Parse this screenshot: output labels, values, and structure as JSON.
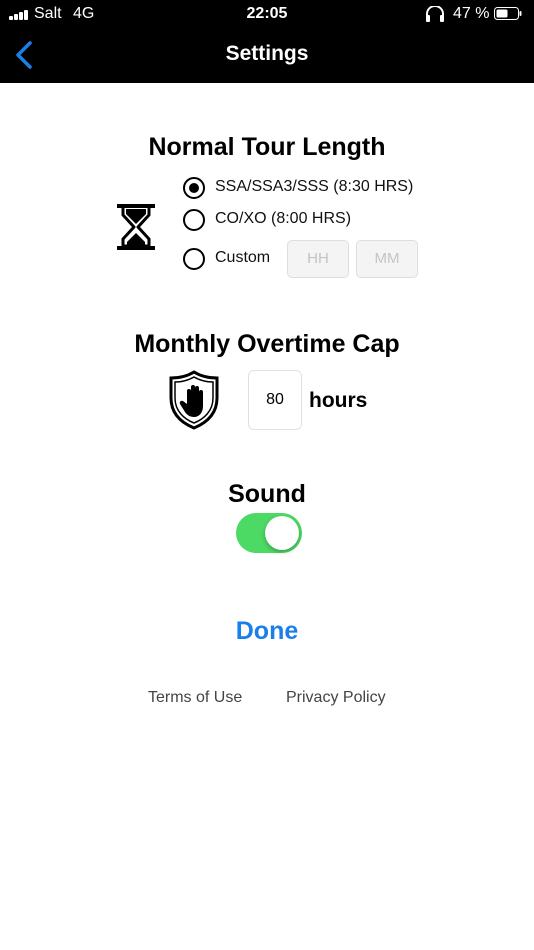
{
  "status_bar": {
    "carrier": "Salt",
    "network": "4G",
    "time": "22:05",
    "battery_percent": "47 %",
    "icons": [
      "signal-icon",
      "headphones-icon",
      "battery-icon"
    ]
  },
  "nav": {
    "back_icon": "chevron-left-icon",
    "title": "Settings"
  },
  "tour_length": {
    "title": "Normal Tour Length",
    "icon": "hourglass-icon",
    "options": [
      {
        "label": "SSA/SSA3/SSS (8:30 HRS)",
        "selected": true
      },
      {
        "label": "CO/XO (8:00 HRS)",
        "selected": false
      },
      {
        "label": "Custom",
        "selected": false
      }
    ],
    "custom_hours_placeholder": "HH",
    "custom_minutes_placeholder": "MM"
  },
  "overtime": {
    "title": "Monthly Overtime Cap",
    "icon": "stop-hand-shield-icon",
    "value": "80",
    "unit": "hours"
  },
  "sound": {
    "title": "Sound",
    "enabled": true
  },
  "done_label": "Done",
  "footer": {
    "terms": "Terms of Use",
    "privacy": "Privacy Policy"
  },
  "colors": {
    "accent": "#1a7fe8",
    "toggle_on": "#4cd964",
    "header_bg": "#000000"
  }
}
